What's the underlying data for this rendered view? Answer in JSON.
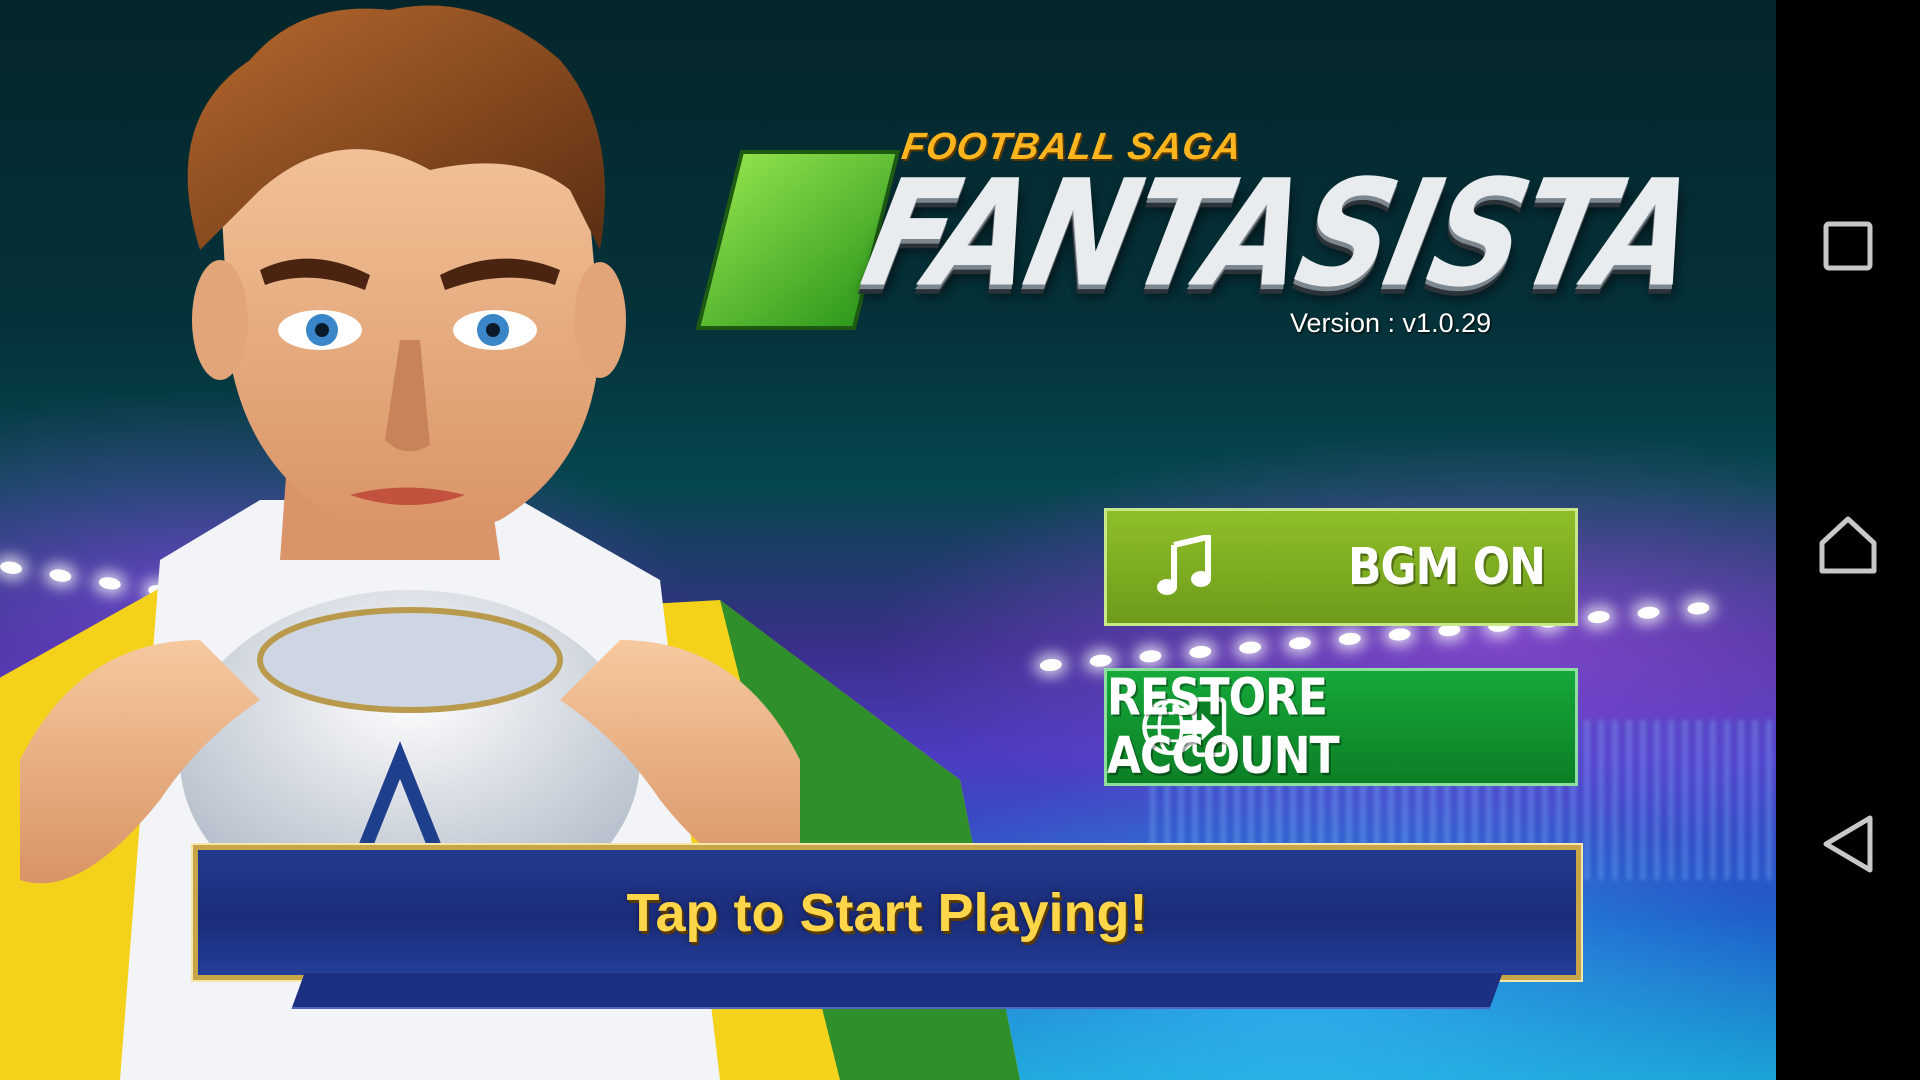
{
  "logo": {
    "subtitle": "FOOTBALL SAGA",
    "title": "FANTASISTA"
  },
  "version_text": "Version : v1.0.29",
  "buttons": {
    "bgm": {
      "label": "BGM ON",
      "icon": "music-note-icon"
    },
    "restore": {
      "label": "RESTORE ACCOUNT",
      "icon": "globe-phone-transfer-icon"
    }
  },
  "start_prompt": "Tap to Start Playing!",
  "nav_bar": {
    "recents_icon": "square-icon",
    "home_icon": "home-icon",
    "back_icon": "back-triangle-icon"
  },
  "colors": {
    "bgm_button": "#7fad22",
    "restore_button": "#0f9430",
    "start_text": "#ffd64a",
    "logo_accent": "#ffb51e"
  }
}
